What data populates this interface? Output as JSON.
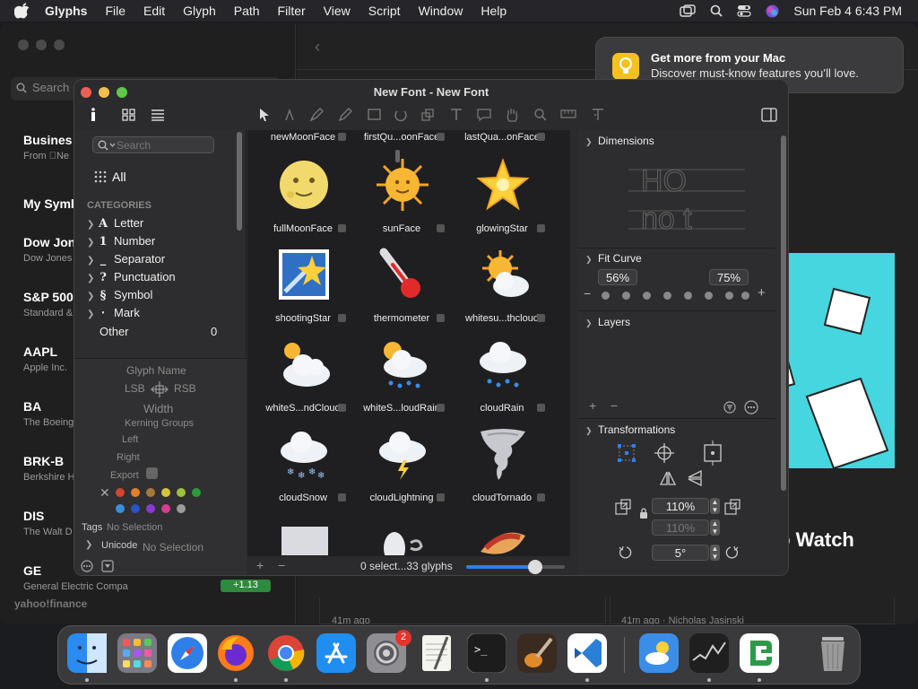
{
  "menubar": {
    "app": "Glyphs",
    "items": [
      "File",
      "Edit",
      "Glyph",
      "Path",
      "Filter",
      "View",
      "Script",
      "Window",
      "Help"
    ],
    "clock": "Sun Feb 4  6:43 PM",
    "icons": [
      "apple-icon",
      "window-icon",
      "search-icon",
      "control-center-icon",
      "siri-icon"
    ]
  },
  "stocks": {
    "search_placeholder": "Search",
    "rows": [
      {
        "symbol": "Busines",
        "name": "From Ne"
      },
      {
        "symbol": "My Symb",
        "name": ""
      },
      {
        "symbol": "Dow Jon",
        "name": "Dow Jones"
      },
      {
        "symbol": "S&P 500",
        "name": "Standard &"
      },
      {
        "symbol": "AAPL",
        "name": "Apple Inc."
      },
      {
        "symbol": "BA",
        "name": "The Boeing"
      },
      {
        "symbol": "BRK-B",
        "name": "Berkshire H"
      },
      {
        "symbol": "DIS",
        "name": "The Walt D"
      },
      {
        "symbol": "GE",
        "name": "General Electric Compa"
      }
    ],
    "footer": "yahoo!finance",
    "pill_value": "+1.13",
    "headline": "y, PayPal, tocks to Watch",
    "byline_left": "41m ago",
    "byline_right": "41m ago · Nicholas Jasinski"
  },
  "notification": {
    "title": "Get more from your Mac",
    "body": "Discover must-know features you’ll love."
  },
  "glyphs_window": {
    "title": "New Font - New Font",
    "sidebar": {
      "search_placeholder": "Search",
      "all_label": "All",
      "categories_header": "CATEGORIES",
      "categories": [
        {
          "icon": "A",
          "label": "Letter"
        },
        {
          "icon": "1",
          "label": "Number"
        },
        {
          "icon": "_",
          "label": "Separator"
        },
        {
          "icon": "?",
          "label": "Punctuation"
        },
        {
          "icon": "§",
          "label": "Symbol"
        },
        {
          "icon": "‧",
          "label": "Mark"
        }
      ],
      "other_label": "Other",
      "other_count": "0"
    },
    "info": {
      "glyph_name": "Glyph Name",
      "lsb": "LSB",
      "rsb": "RSB",
      "width": "Width",
      "kerning_groups": "Kerning Groups",
      "left": "Left",
      "right": "Right",
      "export": "Export",
      "tags_label": "Tags",
      "tags_value": "No Selection",
      "unicode_label": "Unicode",
      "unicode_value": "No Selection",
      "colors": [
        "#d2452f",
        "#e57f27",
        "#a5793a",
        "#d6c53a",
        "#9cc13b",
        "#2b9c3a",
        "#3a8fd6",
        "#2a52c9",
        "#8a3ad1",
        "#d43f90",
        "#9b9b9b"
      ]
    },
    "grid": {
      "top_labels": [
        "newMoonFace",
        "firstQu...oonFace",
        "lastQua...onFace"
      ],
      "cells": [
        {
          "name": "fullMoonFace",
          "icon": "full-moon-face-icon"
        },
        {
          "name": "sunFace",
          "icon": "sun-face-icon"
        },
        {
          "name": "glowingStar",
          "icon": "glowing-star-icon"
        },
        {
          "name": "shootingStar",
          "icon": "shooting-star-icon"
        },
        {
          "name": "thermometer",
          "icon": "thermometer-icon"
        },
        {
          "name": "whitesu...thcloud",
          "icon": "sun-behind-cloud-icon"
        },
        {
          "name": "whiteS...ndCloud",
          "icon": "sun-small-cloud-icon"
        },
        {
          "name": "whiteS...loudRain",
          "icon": "sun-cloud-rain-icon"
        },
        {
          "name": "cloudRain",
          "icon": "cloud-rain-icon"
        },
        {
          "name": "cloudSnow",
          "icon": "cloud-snow-icon"
        },
        {
          "name": "cloudLightning",
          "icon": "cloud-lightning-icon"
        },
        {
          "name": "cloudTornado",
          "icon": "tornado-icon"
        }
      ],
      "status": "0 select...33 glyphs",
      "zoom_level": 0.7
    },
    "inspector": {
      "dimensions": "Dimensions",
      "fit_curve": "Fit Curve",
      "fit_low": "56%",
      "fit_high": "75%",
      "layers": "Layers",
      "transformations": "Transformations",
      "scale_x": "110%",
      "scale_y": "110%",
      "rotate": "5°"
    }
  },
  "dock": {
    "apps": [
      {
        "name": "Finder",
        "icon": "finder-icon",
        "color": "#2a8cf0"
      },
      {
        "name": "Launchpad",
        "icon": "launchpad-icon",
        "color": "#7a7a85"
      },
      {
        "name": "Safari",
        "icon": "safari-icon",
        "color": "#2f7fe8"
      },
      {
        "name": "Firefox",
        "icon": "firefox-icon",
        "color": "#ff7a1a"
      },
      {
        "name": "Chrome",
        "icon": "chrome-icon",
        "color": "#ffffff"
      },
      {
        "name": "App Store",
        "icon": "app-store-icon",
        "color": "#1f8ef0"
      },
      {
        "name": "System Settings",
        "icon": "settings-icon",
        "color": "#8e8e93"
      },
      {
        "name": "TextEdit",
        "icon": "textedit-icon",
        "color": "#f5f5f0"
      },
      {
        "name": "Terminal",
        "icon": "terminal-icon",
        "color": "#1c1c1c"
      },
      {
        "name": "GarageBand",
        "icon": "garageband-icon",
        "color": "#3b2a20"
      },
      {
        "name": "VS Code",
        "icon": "vscode-icon",
        "color": "#2b7fd6"
      },
      {
        "name": "Weather",
        "icon": "weather-icon",
        "color": "#3a8ee8"
      },
      {
        "name": "Stocks",
        "icon": "stocks-icon",
        "color": "#1f1f1f"
      },
      {
        "name": "Glyphs",
        "icon": "glyphs-icon",
        "color": "#ffffff"
      },
      {
        "name": "Trash",
        "icon": "trash-icon",
        "color": "#9a9a9a"
      }
    ],
    "settings_badge": "2"
  }
}
